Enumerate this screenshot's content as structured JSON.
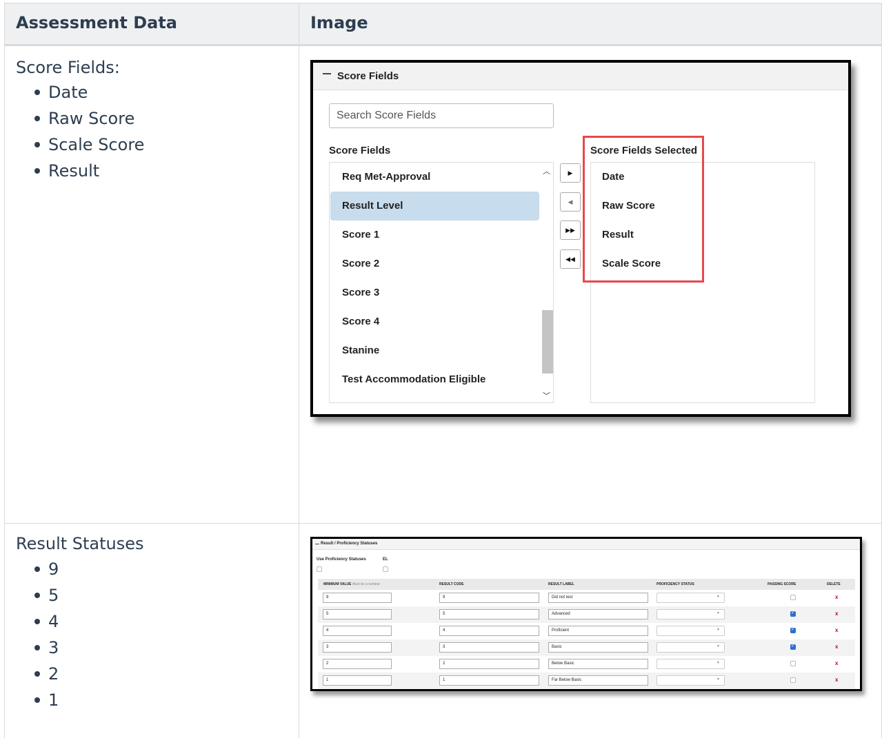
{
  "table": {
    "headers": [
      "Assessment Data",
      "Image"
    ],
    "rows": [
      {
        "label": "Score Fields:",
        "items": [
          "Date",
          "Raw Score",
          "Scale Score",
          "Result"
        ]
      },
      {
        "label": "Result Statuses",
        "items": [
          "9",
          "5",
          "4",
          "3",
          "2",
          "1"
        ]
      }
    ]
  },
  "score_fields_panel": {
    "title": "Score Fields",
    "search_placeholder": "Search Score Fields",
    "available_label": "Score Fields",
    "selected_label": "Score Fields Selected",
    "available": [
      "Req Met-Approval",
      "Result Level",
      "Score 1",
      "Score 2",
      "Score 3",
      "Score 4",
      "Stanine",
      "Test Accommodation Eligible"
    ],
    "selected_available_item": "Result Level",
    "selected": [
      "Date",
      "Raw Score",
      "Result",
      "Scale Score"
    ],
    "buttons": {
      "add": "▶",
      "remove": "◀",
      "add_all": "▶▶",
      "remove_all": "◀◀"
    },
    "scroll_up": "︿",
    "scroll_down": "﹀",
    "highlight_color": "#e8474c"
  },
  "result_panel": {
    "title": "Result / Proficiency Statuses",
    "use_proficiency_label": "Use Proficiency Statuses",
    "el_label": "EL",
    "columns": {
      "min_value": "MINIMUM VALUE",
      "min_value_hint": "Must be a number",
      "result_code": "RESULT CODE",
      "result_label": "RESULT LABEL",
      "proficiency_status": "PROFICIENCY STATUS",
      "passing_score": "PASSING SCORE",
      "delete": "DELETE"
    },
    "rows": [
      {
        "min": "9",
        "code": "9",
        "label": "Did not test",
        "passing": false
      },
      {
        "min": "5",
        "code": "5",
        "label": "Advanced",
        "passing": true
      },
      {
        "min": "4",
        "code": "4",
        "label": "Proficient",
        "passing": true
      },
      {
        "min": "3",
        "code": "3",
        "label": "Basic",
        "passing": true
      },
      {
        "min": "2",
        "code": "2",
        "label": "Below Basic",
        "passing": false
      },
      {
        "min": "1",
        "code": "1",
        "label": "Far Below Basic",
        "passing": false
      }
    ],
    "select_caret": "▼",
    "delete_glyph": "x"
  }
}
